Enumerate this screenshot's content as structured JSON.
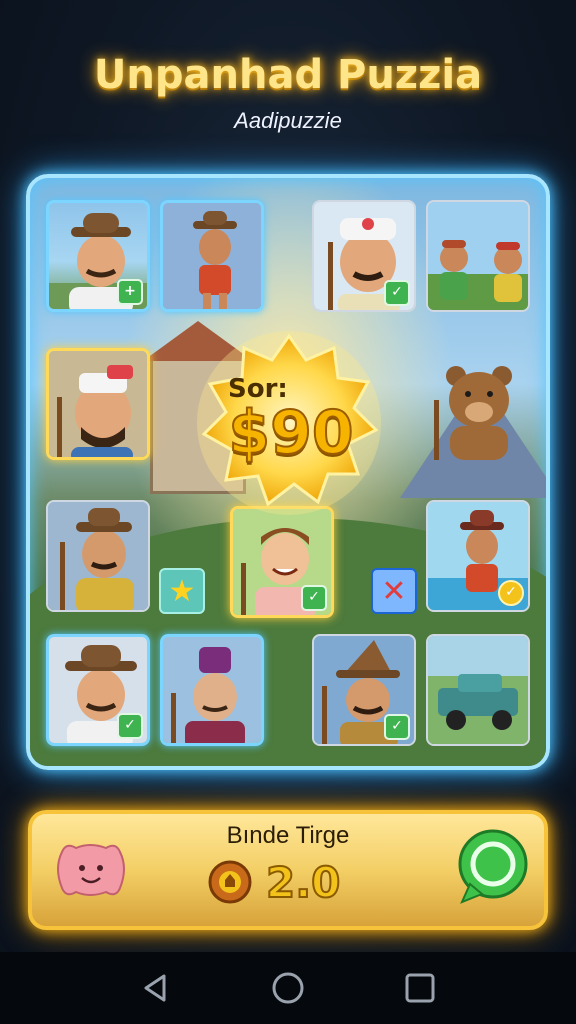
{
  "header": {
    "title": "Unpanhad Puzzia",
    "subtitle": "Aadipuzzie"
  },
  "score": {
    "label": "Sor:",
    "value": "$90"
  },
  "tiles": [
    {
      "name": "man-brown-hat",
      "badge": "+"
    },
    {
      "name": "man-dancing",
      "badge": ""
    },
    {
      "name": "man-turban-cane",
      "badge": "✓"
    },
    {
      "name": "two-farmers",
      "badge": ""
    },
    {
      "name": "man-cap-beard",
      "badge": ""
    },
    {
      "name": "bear-cane",
      "badge": ""
    },
    {
      "name": "man-yellow-coat",
      "badge": ""
    },
    {
      "name": "man-smiling-center",
      "badge": "✓"
    },
    {
      "name": "man-swimming",
      "badge": "✓"
    },
    {
      "name": "man-hat-thumbs-up",
      "badge": "✓"
    },
    {
      "name": "man-purple-hat",
      "badge": ""
    },
    {
      "name": "wizard-cane",
      "badge": "✓"
    },
    {
      "name": "jeep",
      "badge": ""
    }
  ],
  "controls": {
    "star_icon": "★",
    "cancel_icon": "✕"
  },
  "bottom_bar": {
    "label": "Bınde Tirge",
    "coins": "2.0"
  },
  "colors": {
    "accent_gold": "#ffd95a",
    "board_glow": "#52c6ff",
    "check_green": "#3fb34f"
  }
}
